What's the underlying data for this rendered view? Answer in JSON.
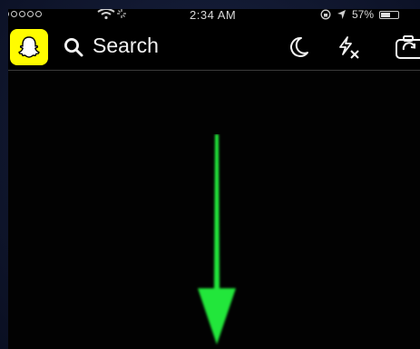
{
  "status_bar": {
    "time": "2:34 AM",
    "battery_percent": "57%",
    "battery_level": 0.57,
    "signal_bars_filled": 1,
    "signal_bars_total": 5
  },
  "top_bar": {
    "search_label": "Search"
  },
  "overlay": {
    "arrow_direction": "down",
    "arrow_color": "#22e63a"
  },
  "colors": {
    "snap_yellow": "#fffc00",
    "background": "#000000"
  }
}
